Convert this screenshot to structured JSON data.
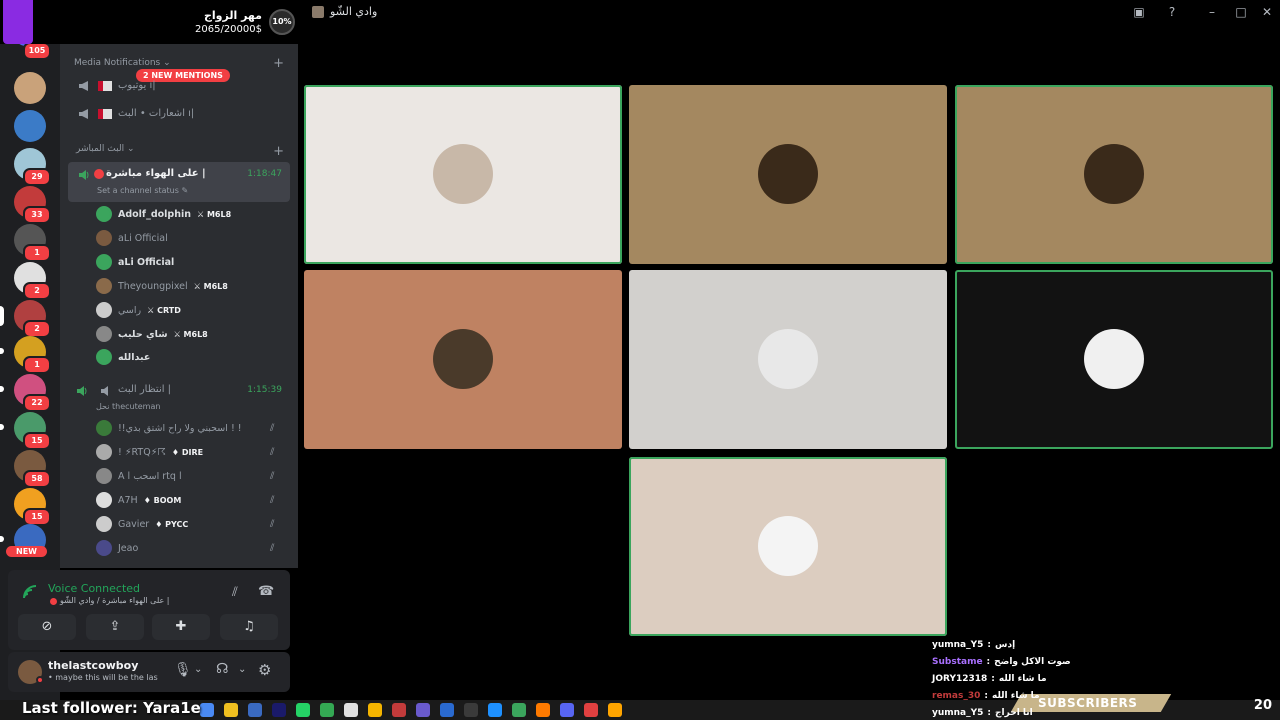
{
  "window": {
    "title": "وادي الشّو"
  },
  "goal": {
    "title": "مهر الزواج",
    "amount": "2065/20000$",
    "percent": "10%"
  },
  "rail": {
    "servers": [
      {
        "badge": "105",
        "color": "#5865f2"
      },
      {
        "badge": "",
        "color": "#c9a27a"
      },
      {
        "badge": "",
        "color": "#3b7bc7"
      },
      {
        "badge": "29",
        "color": "#9fc6d6"
      },
      {
        "badge": "33",
        "color": "#c23b3b"
      },
      {
        "badge": "1",
        "color": "#555555"
      },
      {
        "badge": "2",
        "color": "#e0e0e0"
      },
      {
        "badge": "2",
        "color": "#b04040"
      },
      {
        "badge": "1",
        "color": "#d4a020"
      },
      {
        "badge": "22",
        "color": "#d05080"
      },
      {
        "badge": "15",
        "color": "#4a9a6a"
      },
      {
        "badge": "58",
        "color": "#7a5a40"
      },
      {
        "badge": "15",
        "color": "#f0a020"
      },
      {
        "badge": "",
        "color": "#3a6ac0"
      }
    ],
    "new_label": "NEW"
  },
  "sidebar": {
    "mentions": "2 NEW MENTIONS",
    "cat_media": "Media Notifications",
    "media_channels": [
      "يوتيوب ı|",
      "اشعارات • البث ı|"
    ],
    "cat_live": "البث المباشر",
    "live": {
      "name": "على الهواء مباشرة |",
      "time": "1:18:47",
      "status": "Set a channel status",
      "users": [
        {
          "name": "Adolf_dolphin",
          "tag": "M6L8",
          "dim": false,
          "color": "#3ba55d"
        },
        {
          "name": "aLi Official",
          "tag": "",
          "dim": true,
          "color": "#7a5a40"
        },
        {
          "name": "aLi Official",
          "tag": "",
          "dim": false,
          "color": "#3ba55d"
        },
        {
          "name": "Theyoungpixel",
          "tag": "M6L8",
          "dim": true,
          "color": "#8a6a4a"
        },
        {
          "name": "راسي",
          "tag": "CRTD",
          "dim": true,
          "color": "#cccccc"
        },
        {
          "name": "شاي حليب",
          "tag": "M6L8",
          "dim": false,
          "color": "#888888"
        },
        {
          "name": "عبدالله",
          "tag": "",
          "dim": false,
          "color": "#3ba55d"
        }
      ]
    },
    "waiting": {
      "name": "انتظار البث |",
      "time": "1:15:39",
      "sub": "نحل thecuteman",
      "users": [
        {
          "name": "!!اسحبني ولا راح اشتق بدي ! !",
          "tag": "",
          "color": "#3a7a3a"
        },
        {
          "name": "! ⚡RTQ⚡☈",
          "tag": "DIRE",
          "color": "#aaaaaa"
        },
        {
          "name": "A l اسحب rtq l",
          "tag": "",
          "color": "#888888"
        },
        {
          "name": "A7H",
          "tag": "BOOM",
          "color": "#dddddd"
        },
        {
          "name": "Gavier",
          "tag": "PYCC",
          "color": "#cccccc"
        },
        {
          "name": "Jeao",
          "tag": "",
          "color": "#4a4a8a"
        }
      ]
    }
  },
  "voice": {
    "title": "Voice Connected",
    "sub": "على الهواء مباشرة / وادي الشّو |"
  },
  "me": {
    "name": "thelastcowboy",
    "status": "maybe this will be the last"
  },
  "tiles": [
    {
      "bg": "#ebe7e3",
      "speaking": true,
      "face": "#c8b8a8"
    },
    {
      "bg": "#a48860",
      "speaking": false,
      "face": "#3a2a1a"
    },
    {
      "bg": "#a48860",
      "speaking": true,
      "face": "#3a2a1a"
    },
    {
      "bg": "#bf8262",
      "speaking": false,
      "face": "#4a3a2a"
    },
    {
      "bg": "#d2d0cd",
      "speaking": false,
      "face": "#e8e8e8"
    },
    {
      "bg": "#121212",
      "speaking": true,
      "face": "#f0f0f0"
    },
    {
      "bg": "#dccdc0",
      "speaking": true,
      "face": "#f4f4f4"
    }
  ],
  "overlay": {
    "last_follower": "Last follower: Yara1e",
    "subs": "SUBSCRIBERS",
    "count": "20",
    "chat": [
      {
        "user": "yumna_Y5",
        "msg": "إدس"
      },
      {
        "user": "Substame",
        "msg": "صوت الاكل واضح"
      },
      {
        "user": "JORY12318",
        "msg": "ما شاء الله"
      },
      {
        "user": "remas_30",
        "msg": "ما شاء الله"
      },
      {
        "user": "yumna_Y5",
        "msg": "انا احراج"
      }
    ]
  },
  "colors": {
    "accent_green": "#3ba55d",
    "danger": "#f23f43",
    "purple": "#8a2be2"
  }
}
